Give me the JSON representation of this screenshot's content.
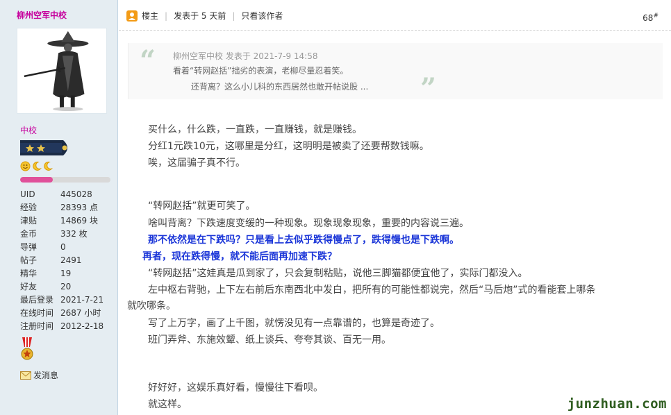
{
  "user": {
    "name": "柳州空军中校",
    "rank_title": "中校",
    "level_progress": 0.36,
    "stats": [
      {
        "label": "UID",
        "value": "445028"
      },
      {
        "label": "经验",
        "value": "28393 点"
      },
      {
        "label": "津贴",
        "value": "14869 块"
      },
      {
        "label": "金币",
        "value": "332 枚"
      },
      {
        "label": "导弹",
        "value": "0"
      },
      {
        "label": "帖子",
        "value": "2491"
      },
      {
        "label": "精华",
        "value": "19"
      },
      {
        "label": "好友",
        "value": "20"
      },
      {
        "label": "最后登录",
        "value": "2021-7-21"
      },
      {
        "label": "在线时间",
        "value": "2687 小时"
      },
      {
        "label": "注册时间",
        "value": "2012-2-18"
      }
    ],
    "send_message": "发消息"
  },
  "topbar": {
    "owner": "楼主",
    "posted": "发表于 5 天前",
    "author_only": "只看该作者",
    "floor": "68",
    "floor_mark": "#"
  },
  "quote": {
    "meta": "柳州空军中校 发表于 2021-7-9 14:58",
    "line1": "看着“转网赵括”拙劣的表演，老柳尽量忍着笑。",
    "line2": "还背离？这么小儿科的东西居然也敢开帖说股 ..."
  },
  "post": {
    "lines": [
      "买什么，什么跌，一直跌，一直赚钱，就是赚钱。",
      "分红1元跌10元，这哪里是分红，这明明是被卖了还要帮数钱嘛。",
      "唉，这届骗子真不行。",
      "“转网赵括”就更可笑了。",
      "啥叫背离？下跌速度变缓的一种现象。现象现象现象，重要的内容说三遍。",
      "那不依然是在下跌吗？只是看上去似乎跌得慢点了，跌得慢也是下跌啊。",
      "再者，现在跌得慢，就不能后面再加速下跌？",
      "“转网赵括”这娃真是瓜到家了，只会复制粘贴，说他三脚猫都便宜他了，实际门都没入。",
      "左中枢右背驰，上下左右前后东南西北中发白，把所有的可能性都说完，然后“马后炮”式的看能套上哪条",
      "就吹哪条。",
      "写了上万字，画了上千图，就愣没见有一点靠谱的，也算是奇迹了。",
      "班门弄斧、东施效颦、纸上谈兵、夸夸其谈、百无一用。",
      "好好好，这娱乐真好看，慢慢往下看呗。",
      "就这样。"
    ]
  },
  "watermark": "junzhuan.com",
  "colors": {
    "username": "#C6009D",
    "emphasis": "#1a35d8",
    "sidebar_bg": "#E5EDF2",
    "watermark": "#2E5D1F"
  }
}
